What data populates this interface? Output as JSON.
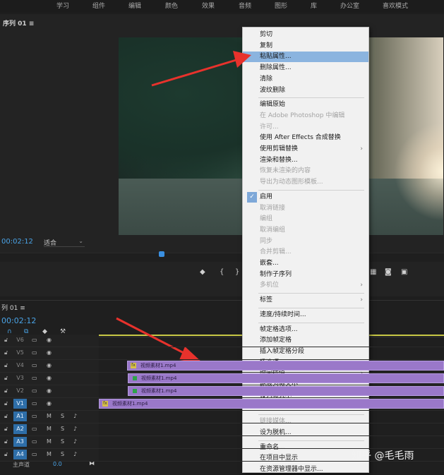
{
  "workspace_tabs": [
    "学习",
    "组件",
    "编辑",
    "颜色",
    "效果",
    "音频",
    "图形",
    "库",
    "办公室",
    "喜欢模式"
  ],
  "monitor": {
    "tab_label": "序列 01",
    "timecode": "00:02:12",
    "fit_value": "适合"
  },
  "timeline": {
    "tab_label": "列 01",
    "timecode": "00:02:12",
    "master_label": "主声道",
    "master_value": "0.0",
    "ruler_color": "#c8c845",
    "clip_color": "#9a78c9",
    "tracks": [
      {
        "name": "V6",
        "active": false
      },
      {
        "name": "V5",
        "active": false
      },
      {
        "name": "V4",
        "active": false
      },
      {
        "name": "V3",
        "active": false
      },
      {
        "name": "V2",
        "active": false
      },
      {
        "name": "V1",
        "active": true
      },
      {
        "name": "A1",
        "active": true
      },
      {
        "name": "A2",
        "active": true
      },
      {
        "name": "A3",
        "active": true
      },
      {
        "name": "A4",
        "active": true
      }
    ],
    "clips": [
      {
        "track": "V4",
        "label": "视频素材1.mp4",
        "icon": "fx"
      },
      {
        "track": "V3",
        "label": "视频素材1.mp4",
        "icon": "graphic"
      },
      {
        "track": "V2",
        "label": "视频素材1.mp4",
        "icon": "graphic"
      },
      {
        "track": "V1",
        "label": "视频素材1.mp4",
        "icon": "fx"
      }
    ]
  },
  "context_menu": {
    "items": [
      {
        "label": "剪切",
        "disabled": false
      },
      {
        "label": "复制",
        "disabled": false
      },
      {
        "label": "粘贴属性...",
        "disabled": false,
        "highlighted": true
      },
      {
        "label": "删除属性...",
        "disabled": false
      },
      {
        "label": "清除",
        "disabled": false
      },
      {
        "label": "波纹删除",
        "disabled": false
      },
      {
        "sep": true
      },
      {
        "label": "编辑原始",
        "disabled": false
      },
      {
        "label": "在 Adobe Photoshop 中编辑",
        "disabled": true
      },
      {
        "label": "许可...",
        "disabled": true
      },
      {
        "label": "使用 After Effects 合成替换",
        "disabled": false
      },
      {
        "label": "使用剪辑替换",
        "disabled": false,
        "submenu": true
      },
      {
        "label": "渲染和替换...",
        "disabled": false
      },
      {
        "label": "恢复未渲染的内容",
        "disabled": true
      },
      {
        "label": "导出为动态图形模板...",
        "disabled": true
      },
      {
        "sep": true
      },
      {
        "label": "启用",
        "disabled": false,
        "checked": true
      },
      {
        "label": "取消链接",
        "disabled": true
      },
      {
        "label": "编组",
        "disabled": true
      },
      {
        "label": "取消编组",
        "disabled": true
      },
      {
        "label": "同步",
        "disabled": true
      },
      {
        "label": "合并剪辑...",
        "disabled": true
      },
      {
        "label": "嵌套...",
        "disabled": false
      },
      {
        "label": "制作子序列",
        "disabled": false
      },
      {
        "label": "多机位",
        "disabled": true,
        "submenu": true
      },
      {
        "sep": true
      },
      {
        "label": "标签",
        "disabled": false,
        "submenu": true
      },
      {
        "sep": true
      },
      {
        "label": "速度/持续时间...",
        "disabled": false
      },
      {
        "sep": true
      },
      {
        "label": "帧定格选项...",
        "disabled": false
      },
      {
        "label": "添加帧定格",
        "disabled": false
      },
      {
        "label": "插入帧定格分段",
        "disabled": false
      },
      {
        "label": "场选项...",
        "disabled": false
      },
      {
        "label": "时间插值",
        "disabled": false,
        "submenu": true
      },
      {
        "label": "缩放为帧大小",
        "disabled": false
      },
      {
        "label": "设为帧大小",
        "disabled": false
      },
      {
        "label": "调整图层",
        "disabled": false
      },
      {
        "sep": true
      },
      {
        "label": "链接媒体...",
        "disabled": true
      },
      {
        "label": "设为脱机...",
        "disabled": false
      },
      {
        "sep": true
      },
      {
        "label": "重命名...",
        "disabled": false
      },
      {
        "label": "在项目中显示",
        "disabled": false
      },
      {
        "label": "在资源管理器中显示...",
        "disabled": false
      }
    ]
  },
  "annotation_color": "#e8322c",
  "watermark": "知乎 @毛毛雨"
}
